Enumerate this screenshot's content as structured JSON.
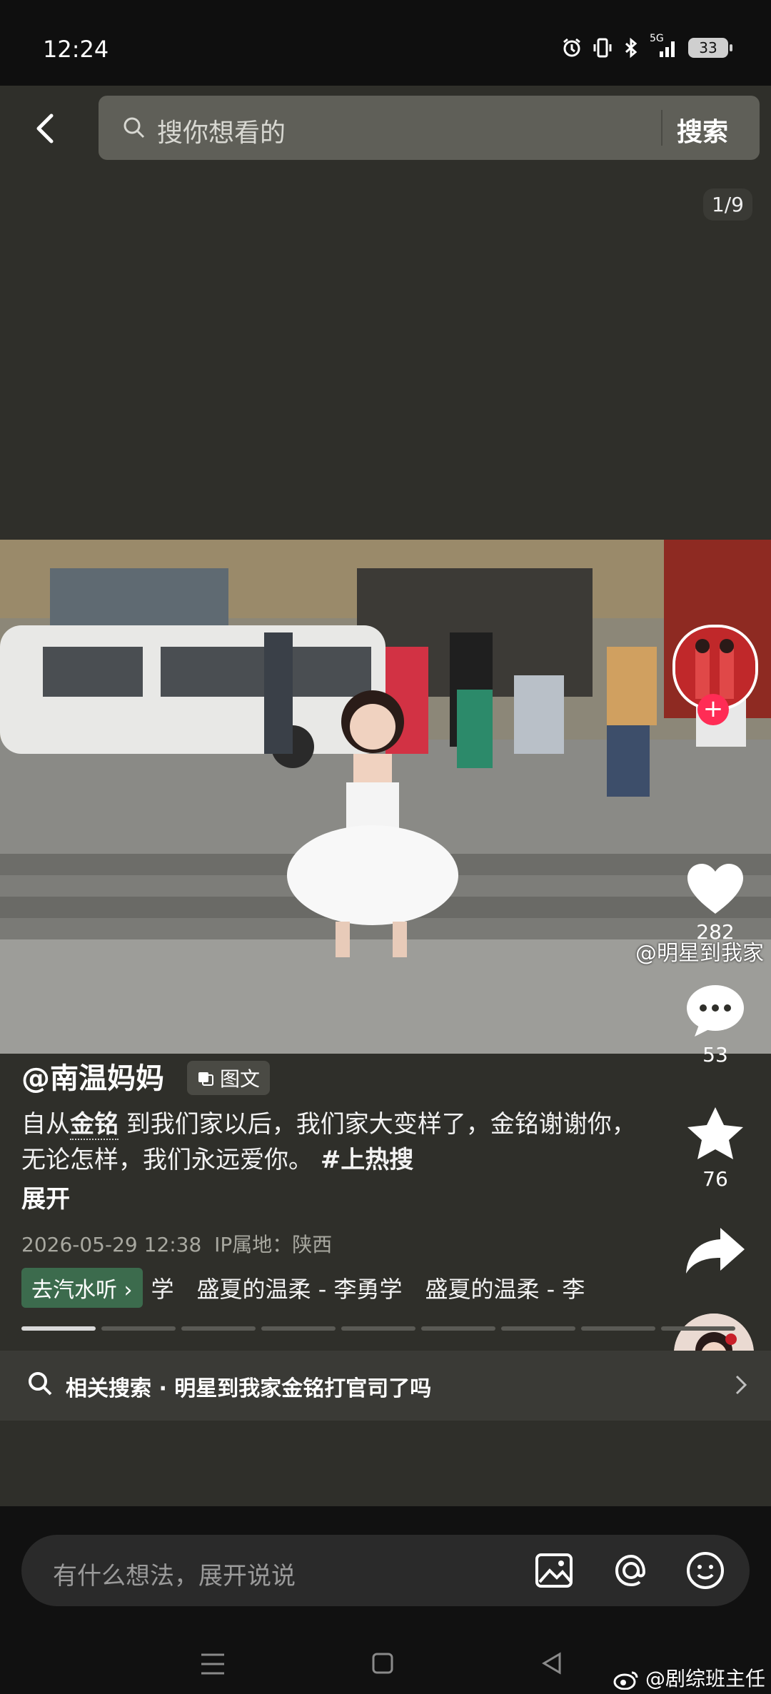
{
  "status_bar": {
    "time": "12:24",
    "battery": "33",
    "network": "5G"
  },
  "header": {
    "search_placeholder": "搜你想看的",
    "search_button": "搜索",
    "image_counter": "1/9"
  },
  "photo": {
    "watermark": "@明星到我家"
  },
  "actions": {
    "likes": "282",
    "comments": "53",
    "favorites": "76"
  },
  "post": {
    "author": "@南温妈妈",
    "type_badge": "图文",
    "caption_prefix": "自从",
    "caption_highlight": "金铭",
    "caption_body": " 到我们家以后，我们家大变样了，金铭谢谢你，无论怎样，我们永远爱你。",
    "caption_tag": "#上热搜",
    "expand": "展开",
    "date": "2026-05-29 12:38",
    "ip_location": "IP属地：陕西",
    "music_chip": "去汽水听",
    "music_track": "学　盛夏的温柔 - 李勇学　盛夏的温柔 - 李",
    "pages_total": 9,
    "page_current": 1
  },
  "related": {
    "text": "相关搜索 · 明星到我家金铭打官司了吗"
  },
  "comment_input": {
    "placeholder": "有什么想法，展开说说"
  },
  "credit": "@剧综班主任",
  "colors": {
    "page_bg": "#2f2f2a",
    "accent": "#ff2c55",
    "music_chip": "#3c6b4d"
  }
}
